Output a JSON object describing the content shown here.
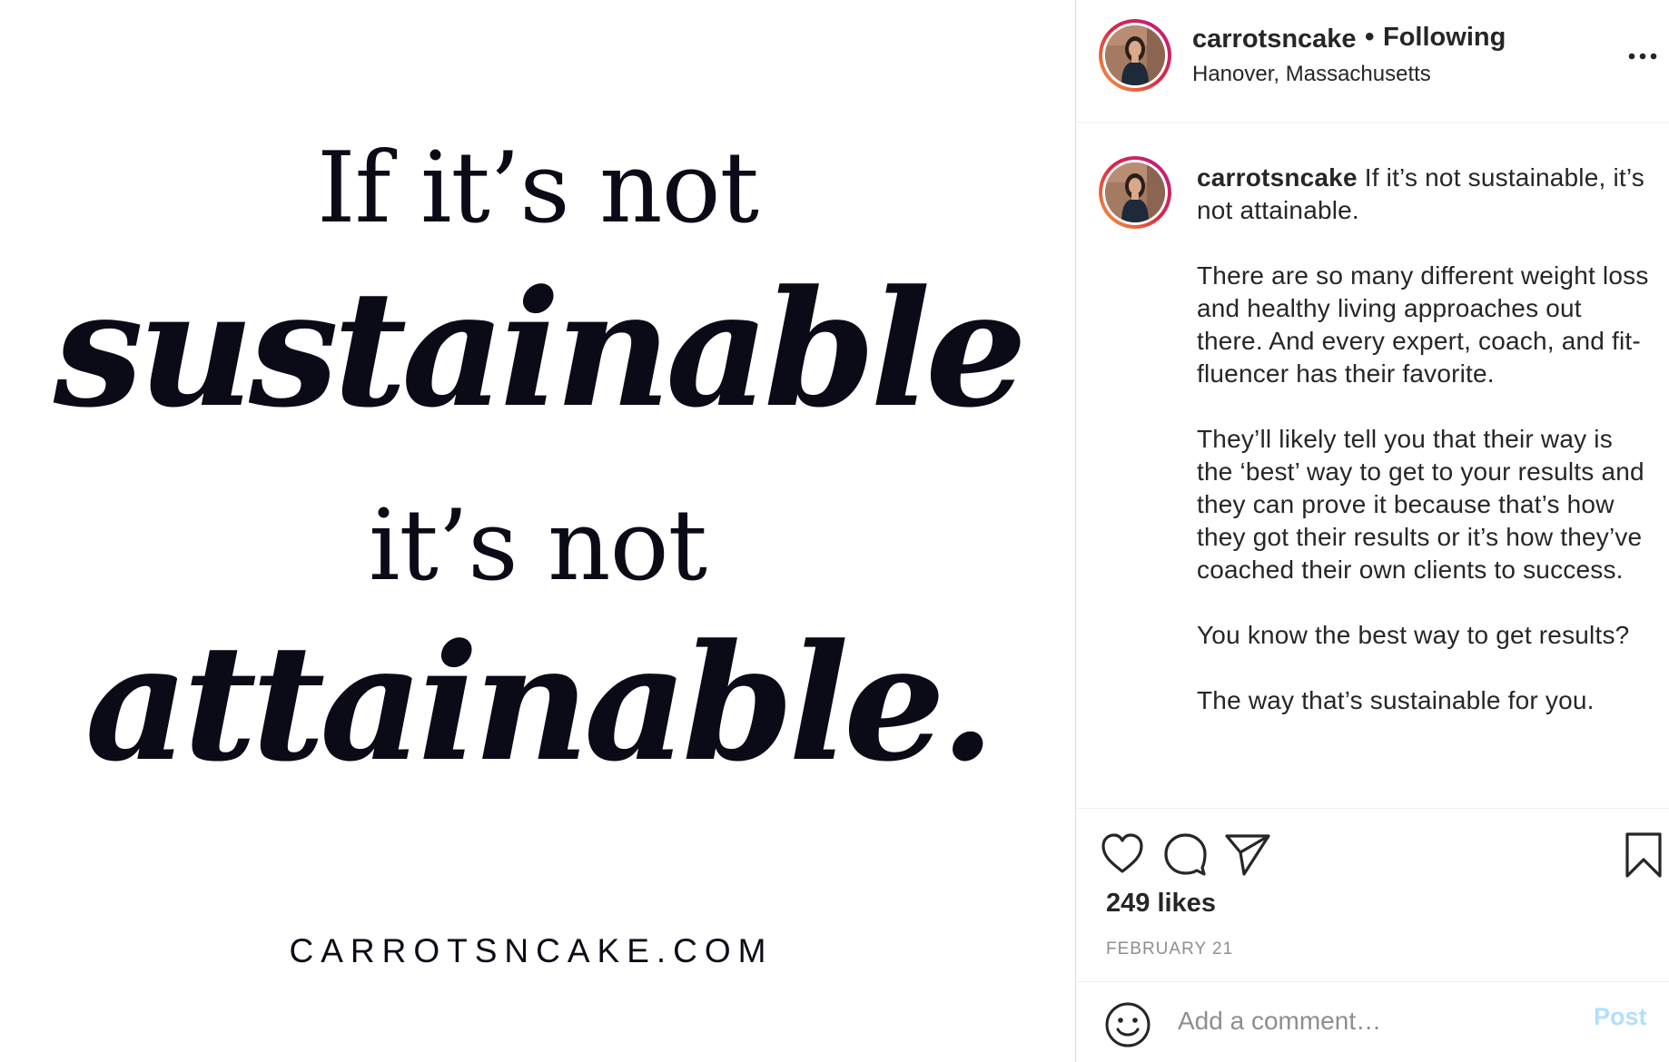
{
  "post_image": {
    "line1": "If it’s not",
    "line2": "sustainable",
    "line3": "it’s not",
    "line4": "attainable.",
    "url": "CARROTSNCAKE.COM"
  },
  "header": {
    "username": "carrotsncake",
    "separator": "•",
    "follow_status": "Following",
    "location": "Hanover, Massachusetts",
    "more_icon": "more-horizontal-icon"
  },
  "caption": {
    "username": "carrotsncake",
    "first_line": " If it’s not sustainable, it’s not attainable.",
    "paragraphs": [
      "There are so many different weight loss and healthy living approaches out there. And every expert, coach, and fit-fluencer has their favorite.",
      "They’ll likely tell you that their way is the ‘best’ way to get to your results and they can prove it because that’s how they got their results or it’s how they’ve coached their own clients to success.",
      "You know the best way to get results?",
      "The way that’s sustainable for you."
    ]
  },
  "actions": {
    "icons": [
      "heart-icon",
      "comment-icon",
      "share-icon",
      "bookmark-icon"
    ],
    "likes": "249 likes",
    "date": "FEBRUARY 21"
  },
  "comment": {
    "emoji_icon": "emoji-icon",
    "placeholder": "Add a comment…",
    "post_label": "Post"
  },
  "colors": {
    "text": "#262626",
    "muted": "#8e8e8e",
    "post_disabled": "#b2dffc",
    "quote_ink": "#0b0b18"
  }
}
